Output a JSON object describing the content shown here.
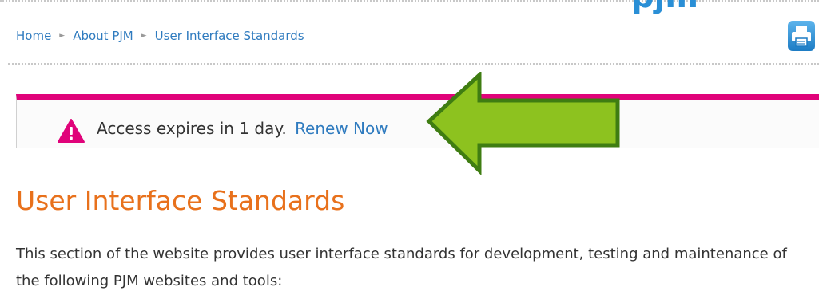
{
  "header": {
    "logo_text": "pjm"
  },
  "breadcrumb": {
    "items": [
      "Home",
      "About PJM",
      "User Interface Standards"
    ],
    "separator": "►"
  },
  "icons": {
    "print": "print-icon",
    "alert": "warning-triangle-icon"
  },
  "alert": {
    "message": "Access expires in 1 day.",
    "link_label": "Renew Now",
    "accent_color": "#e0037a"
  },
  "annotation": {
    "arrow_color": "#8dc21f"
  },
  "main": {
    "title": "User Interface Standards",
    "intro": "This section of the website provides user interface standards for development, testing and maintenance of the following PJM websites and tools:"
  }
}
